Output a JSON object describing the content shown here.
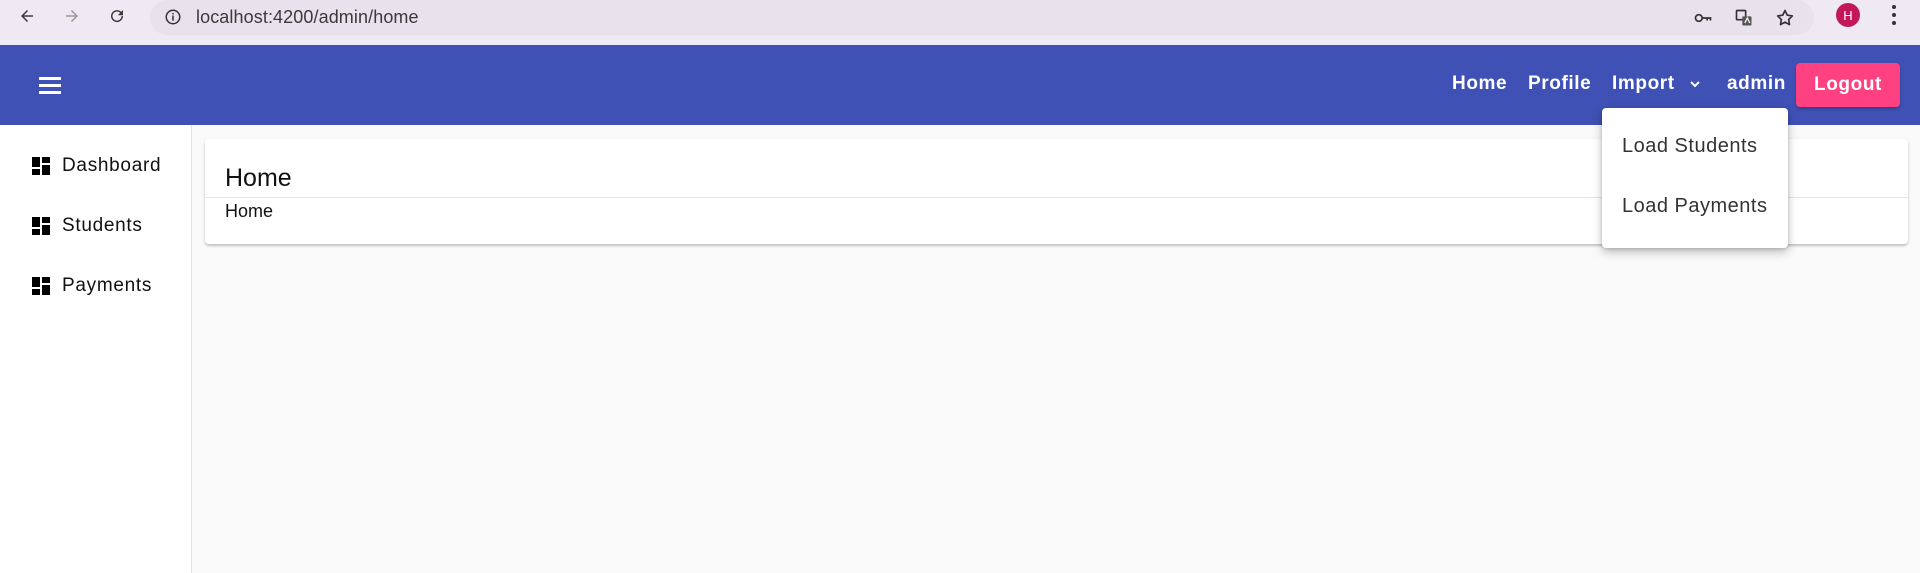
{
  "browser": {
    "url": "localhost:4200/admin/home",
    "avatar_initial": "H"
  },
  "toolbar": {
    "nav": {
      "home": "Home",
      "profile": "Profile",
      "import": "Import",
      "user": "admin"
    },
    "logout_label": "Logout",
    "colors": {
      "primary": "#3f51b5",
      "accent": "#ff4081"
    }
  },
  "sidebar": {
    "items": [
      {
        "label": "Dashboard",
        "icon": "dashboard-icon"
      },
      {
        "label": "Students",
        "icon": "dashboard-icon"
      },
      {
        "label": "Payments",
        "icon": "dashboard-icon"
      }
    ]
  },
  "main": {
    "card_title": "Home",
    "card_body": "Home"
  },
  "import_menu": {
    "items": [
      {
        "label": "Load Students"
      },
      {
        "label": "Load Payments"
      }
    ]
  }
}
